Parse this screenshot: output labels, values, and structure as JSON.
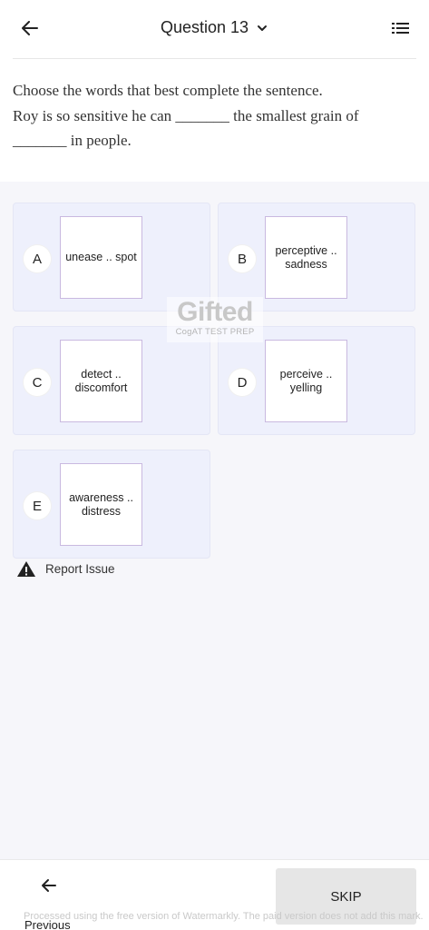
{
  "header": {
    "title": "Question 13",
    "back_icon": "arrow-left-icon",
    "dropdown_icon": "chevron-down-icon",
    "menu_icon": "list-icon"
  },
  "question": {
    "line1": "Choose the words that best complete the sentence.",
    "line2": "Roy is so sensitive he can _______ the smallest grain of",
    "line3": "_______ in people."
  },
  "options": [
    {
      "letter": "A",
      "text": "unease .. spot"
    },
    {
      "letter": "B",
      "text": "perceptive .. sadness"
    },
    {
      "letter": "C",
      "text": "detect .. discomfort"
    },
    {
      "letter": "D",
      "text": "perceive .. yelling"
    },
    {
      "letter": "E",
      "text": "awareness .. distress"
    }
  ],
  "watermark": {
    "brand": "Gifted",
    "tagline": "CogAT TEST PREP"
  },
  "report": {
    "label": "Report Issue",
    "icon": "warning-icon"
  },
  "footer": {
    "previous_label": "Previous",
    "skip_label": "SKIP",
    "notice": "Processed using the free version of Watermarkly. The paid version does not add this mark."
  }
}
